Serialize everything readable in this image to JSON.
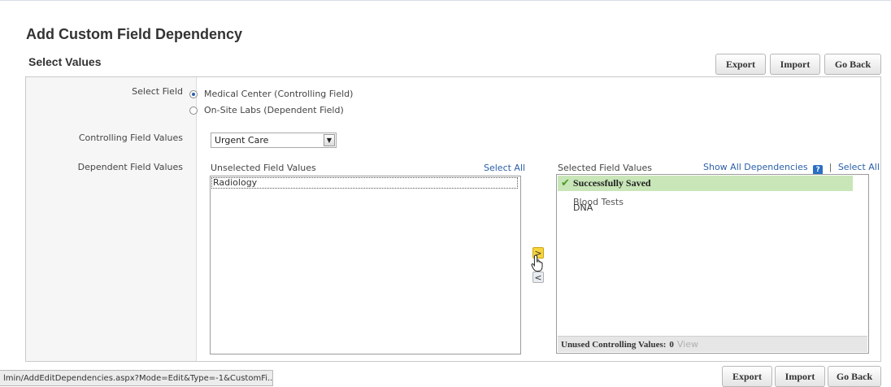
{
  "page": {
    "title": "Add Custom Field Dependency",
    "section_title": "Select Values"
  },
  "toolbar_top": {
    "export_label": "Export",
    "import_label": "Import",
    "go_back_label": "Go Back"
  },
  "toolbar_bottom": {
    "export_label": "Export",
    "import_label": "Import",
    "go_back_label": "Go Back"
  },
  "form": {
    "select_field_label": "Select Field",
    "radio_options": [
      {
        "label": "Medical Center (Controlling Field)",
        "checked": true
      },
      {
        "label": "On-Site Labs (Dependent Field)",
        "checked": false
      }
    ],
    "controlling_values_label": "Controlling Field Values",
    "controlling_select_value": "Urgent Care",
    "dependent_values_label": "Dependent Field Values"
  },
  "unselected": {
    "header": "Unselected Field Values",
    "select_all": "Select All",
    "items": [
      "Radiology"
    ]
  },
  "selected": {
    "header": "Selected Field Values",
    "show_all_dependencies": "Show All Dependencies",
    "separator": "|",
    "select_all": "Select All",
    "success_message": "Successfully Saved",
    "items": [
      "Blood Tests",
      "DNA"
    ],
    "footer_label": "Unused Controlling Values:",
    "footer_count": "0",
    "footer_view": "View"
  },
  "move_buttons": {
    "add": ">",
    "remove": "<"
  },
  "status_url": "lmin/AddEditDependencies.aspx?Mode=Edit&Type=-1&CustomFi...",
  "colors": {
    "success_bg": "#c8e6b8",
    "link": "#2a5fa8",
    "add_button_bg": "#f7d33c"
  },
  "icons": {
    "help": "help-icon",
    "check": "check-icon",
    "cursor": "hand-pointer-icon"
  }
}
